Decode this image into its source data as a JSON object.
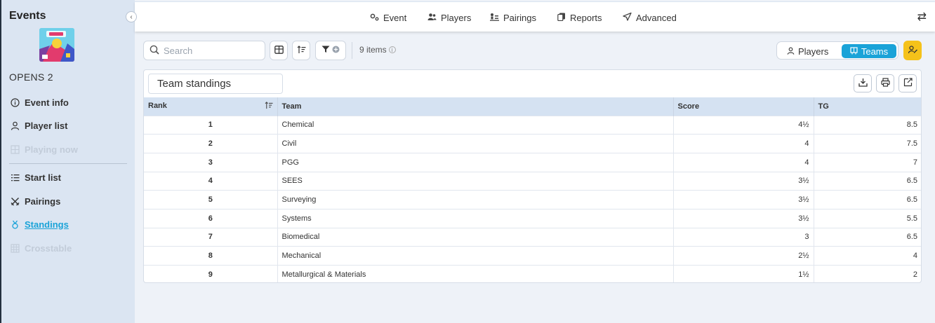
{
  "sidebar": {
    "title": "Events",
    "event_name": "OPENS 2",
    "collapse_icon": "chevron-left-icon",
    "items": [
      {
        "label": "Event info",
        "icon": "info-icon",
        "state": "normal"
      },
      {
        "label": "Player list",
        "icon": "user-icon",
        "state": "normal"
      },
      {
        "label": "Playing now",
        "icon": "grid-icon",
        "state": "disabled"
      },
      {
        "label": "Start list",
        "icon": "list-icon",
        "state": "normal"
      },
      {
        "label": "Pairings",
        "icon": "swords-icon",
        "state": "normal"
      },
      {
        "label": "Standings",
        "icon": "medal-icon",
        "state": "active"
      },
      {
        "label": "Crosstable",
        "icon": "table-icon",
        "state": "disabled"
      }
    ]
  },
  "topnav": {
    "items": [
      {
        "label": "Event",
        "icon": "gears-icon"
      },
      {
        "label": "Players",
        "icon": "users-icon"
      },
      {
        "label": "Pairings",
        "icon": "pairings-icon"
      },
      {
        "label": "Reports",
        "icon": "copy-icon"
      },
      {
        "label": "Advanced",
        "icon": "send-icon"
      }
    ]
  },
  "toolbar": {
    "search_placeholder": "Search",
    "search_value": "",
    "items_count": "9 items",
    "toggle": {
      "players_label": "Players",
      "teams_label": "Teams",
      "selected": "Teams"
    }
  },
  "panel": {
    "title": "Team standings"
  },
  "table": {
    "columns": [
      "Rank",
      "Team",
      "Score",
      "TG"
    ],
    "rows": [
      [
        "1",
        "Chemical",
        "4½",
        "8.5"
      ],
      [
        "2",
        "Civil",
        "4",
        "7.5"
      ],
      [
        "3",
        "PGG",
        "4",
        "7"
      ],
      [
        "4",
        "SEES",
        "3½",
        "6.5"
      ],
      [
        "5",
        "Surveying",
        "3½",
        "6.5"
      ],
      [
        "6",
        "Systems",
        "3½",
        "5.5"
      ],
      [
        "7",
        "Biomedical",
        "3",
        "6.5"
      ],
      [
        "8",
        "Mechanical",
        "2½",
        "4"
      ],
      [
        "9",
        "Metallurgical & Materials",
        "1½",
        "2"
      ]
    ]
  },
  "colors": {
    "accent": "#1aa3d8",
    "yellow_button": "#f5c21a",
    "sidebar_bg": "#dbe5f2",
    "table_header_bg": "#d5e2f2"
  }
}
